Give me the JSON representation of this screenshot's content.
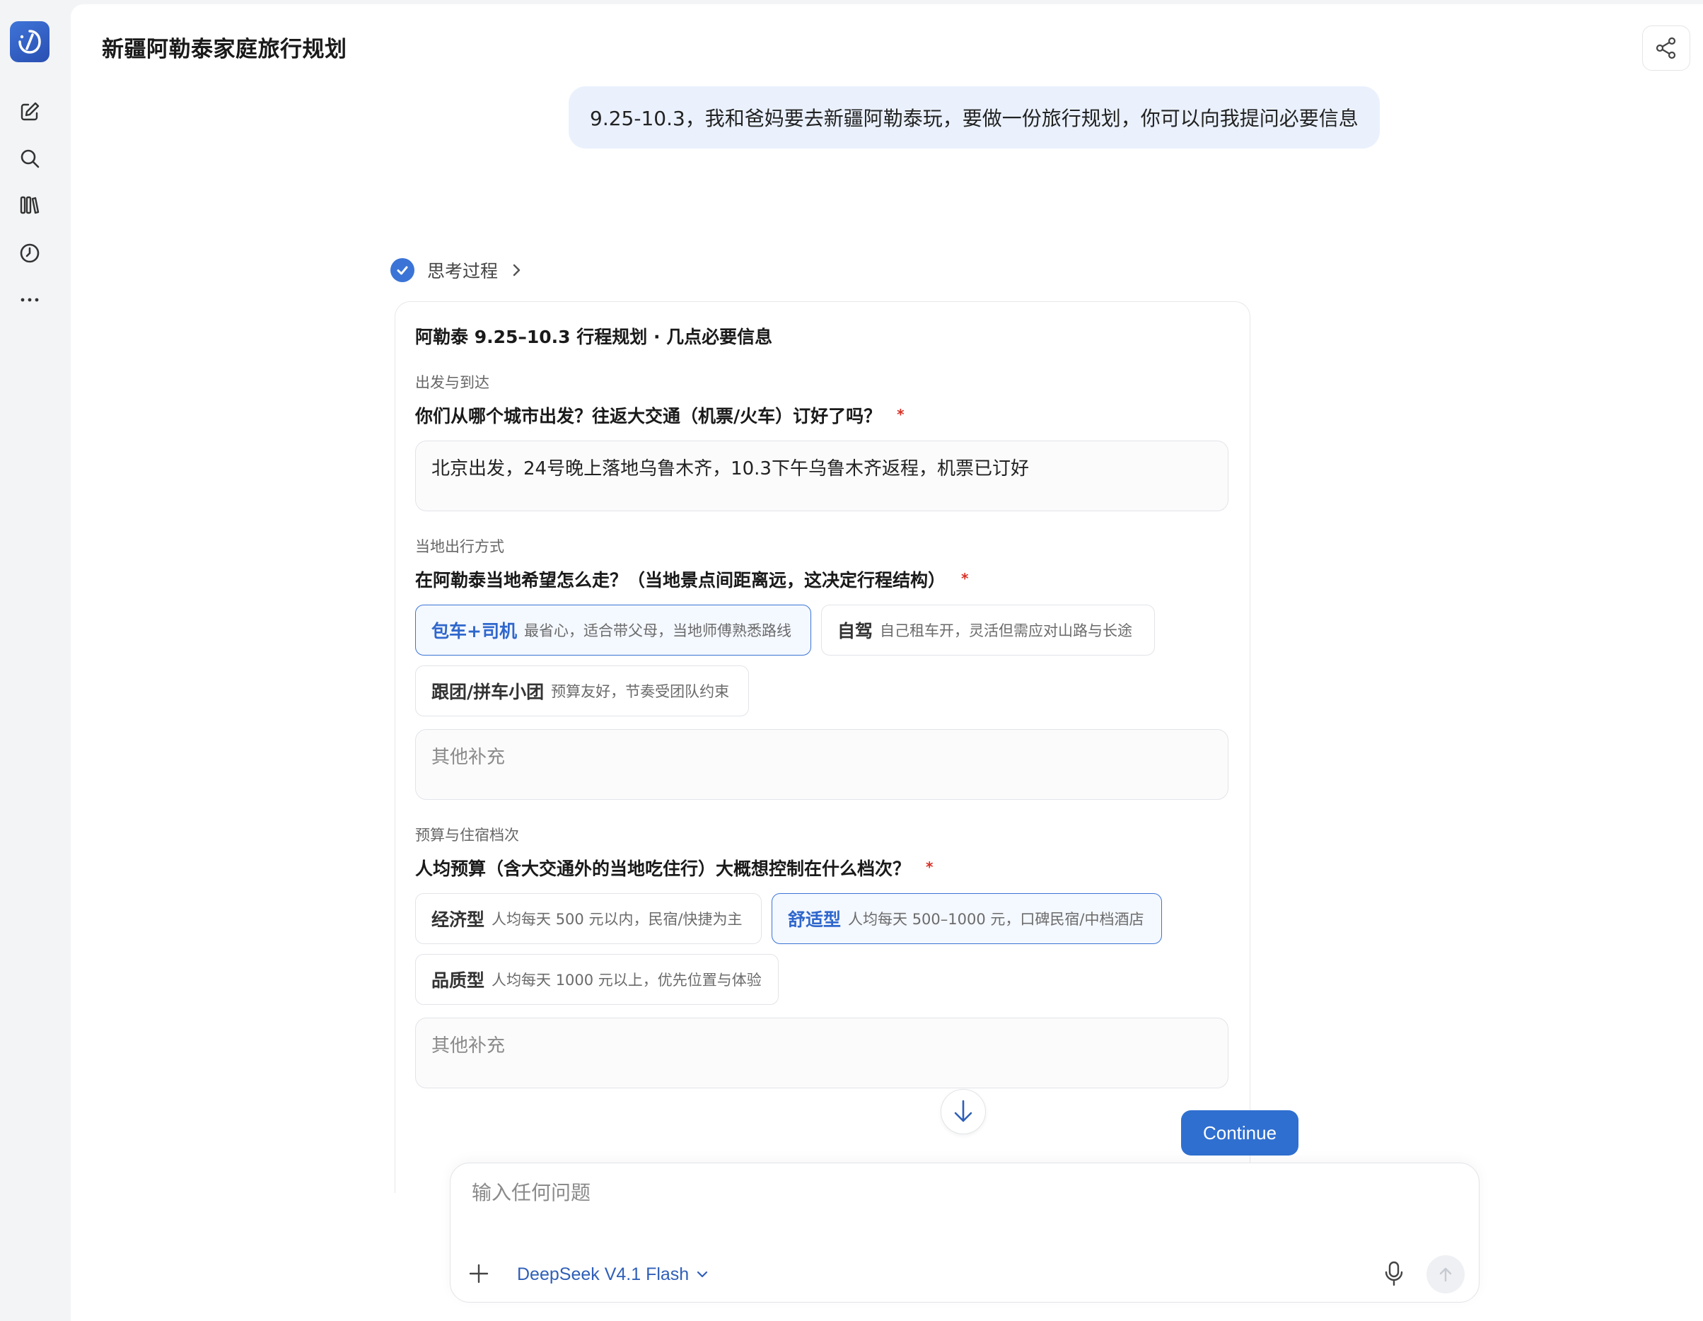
{
  "header": {
    "title": "新疆阿勒泰家庭旅行规划"
  },
  "chat": {
    "user_message": "9.25-10.3，我和爸妈要去新疆阿勒泰玩，要做一份旅行规划，你可以向我提问必要信息",
    "thinking_label": "思考过程"
  },
  "form": {
    "title": "阿勒泰 9.25–10.3 行程规划 · 几点必要信息",
    "required_mark": "*",
    "sections": [
      {
        "label": "出发与到达",
        "question": "你们从哪个城市出发？往返大交通（机票/火车）订好了吗？",
        "answer": "北京出发，24号晚上落地乌鲁木齐，10.3下午乌鲁木齐返程，机票已订好"
      },
      {
        "label": "当地出行方式",
        "question": "在阿勒泰当地希望怎么走？（当地景点间距离远，这决定行程结构）",
        "options": [
          {
            "title": "包车+司机",
            "desc": "最省心，适合带父母，当地师傅熟悉路线",
            "selected": true
          },
          {
            "title": "自驾",
            "desc": "自己租车开，灵活但需应对山路与长途",
            "selected": false
          },
          {
            "title": "跟团/拼车小团",
            "desc": "预算友好，节奏受团队约束",
            "selected": false
          }
        ],
        "other_placeholder": "其他补充"
      },
      {
        "label": "预算与住宿档次",
        "question": "人均预算（含大交通外的当地吃住行）大概想控制在什么档次？",
        "options": [
          {
            "title": "经济型",
            "desc": "人均每天 500 元以内，民宿/快捷为主",
            "selected": false
          },
          {
            "title": "舒适型",
            "desc": "人均每天 500–1000 元，口碑民宿/中档酒店",
            "selected": true
          },
          {
            "title": "品质型",
            "desc": "人均每天 1000 元以上，优先位置与体验",
            "selected": false
          }
        ],
        "other_placeholder": "其他补充"
      }
    ],
    "continue_label": "Continue"
  },
  "composer": {
    "placeholder": "输入任何问题",
    "model": "DeepSeek V4.1 Flash"
  },
  "icons": {
    "sidebar": [
      "logo-icon",
      "new-chat-icon",
      "search-icon",
      "library-icon",
      "history-icon",
      "more-icon"
    ],
    "share": "share-icon"
  },
  "colors": {
    "accent": "#2f6fd0",
    "bubble": "#eaf1fd",
    "required": "#d93025"
  }
}
